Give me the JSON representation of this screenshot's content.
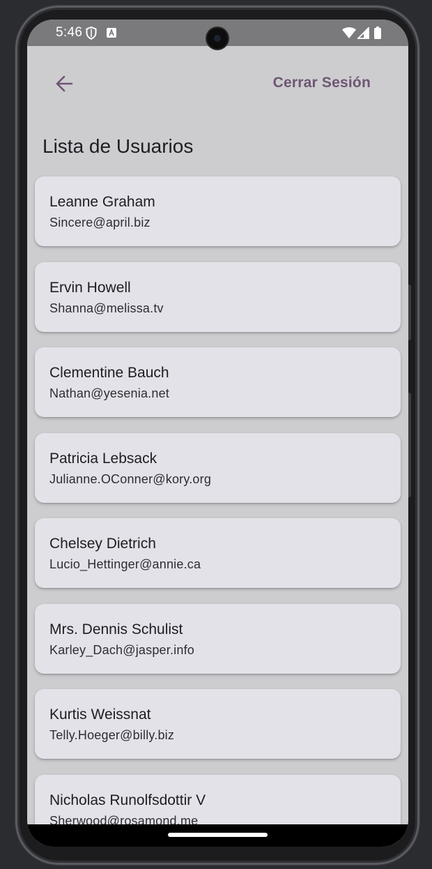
{
  "status_bar": {
    "time": "5:46"
  },
  "app_bar": {
    "back_icon": "arrow-left-icon",
    "logout_label": "Cerrar Sesión",
    "accent_color": "#6e5672"
  },
  "page": {
    "title": "Lista de Usuarios"
  },
  "users": [
    {
      "name": "Leanne Graham",
      "email": "Sincere@april.biz"
    },
    {
      "name": "Ervin Howell",
      "email": "Shanna@melissa.tv"
    },
    {
      "name": "Clementine Bauch",
      "email": "Nathan@yesenia.net"
    },
    {
      "name": "Patricia Lebsack",
      "email": "Julianne.OConner@kory.org"
    },
    {
      "name": "Chelsey Dietrich",
      "email": "Lucio_Hettinger@annie.ca"
    },
    {
      "name": "Mrs. Dennis Schulist",
      "email": "Karley_Dach@jasper.info"
    },
    {
      "name": "Kurtis Weissnat",
      "email": "Telly.Hoeger@billy.biz"
    },
    {
      "name": "Nicholas Runolfsdottir V",
      "email": "Sherwood@rosamond.me"
    }
  ]
}
